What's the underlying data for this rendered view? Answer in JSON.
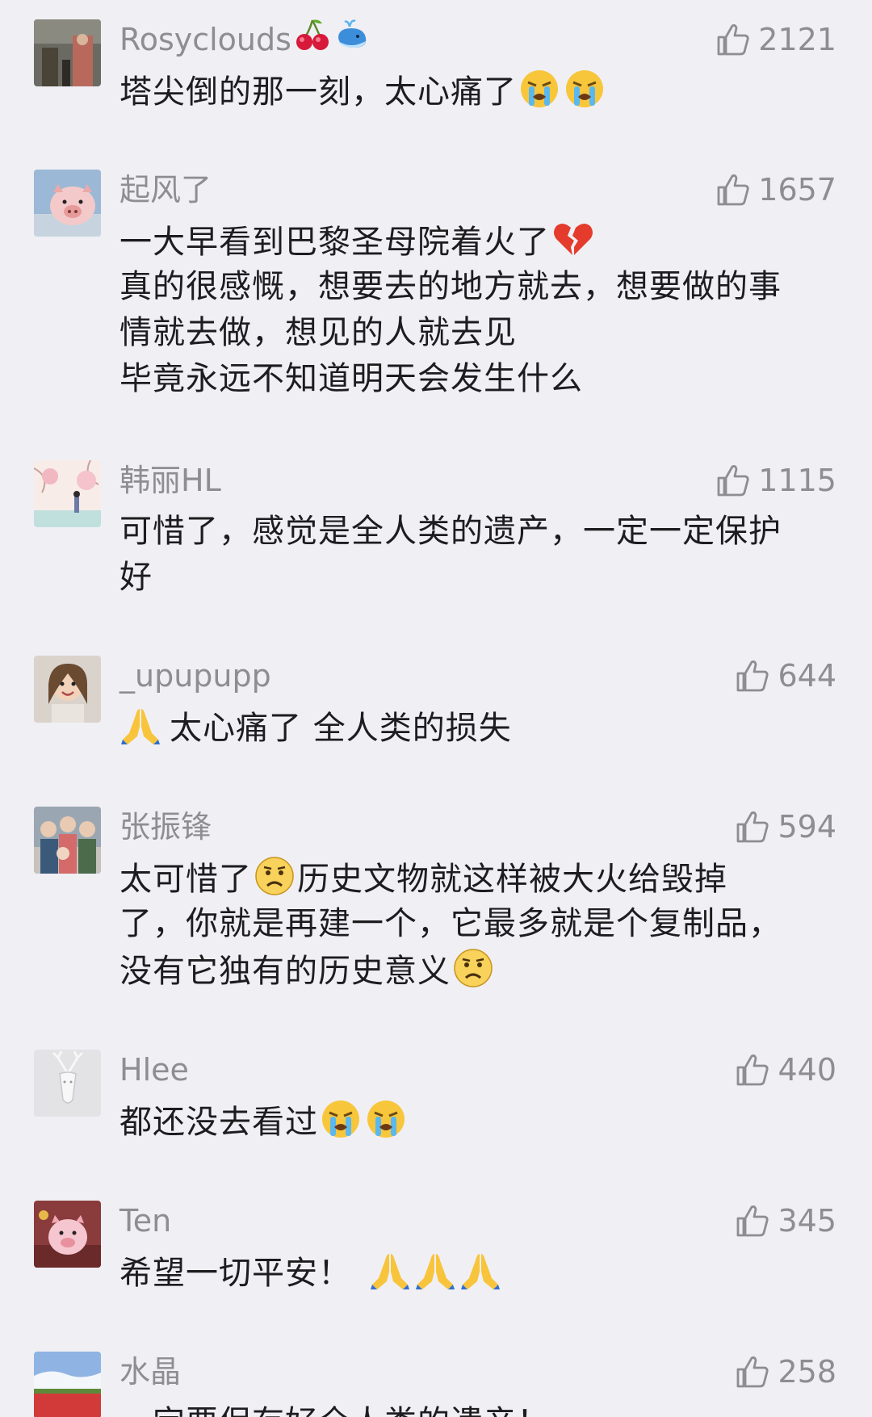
{
  "comments": [
    {
      "username": "Rosyclouds",
      "likes": "2121",
      "lines": [
        "塔尖倒的那一刻，太心痛了"
      ],
      "username_emoji": [
        "cherry-emoji",
        "whale-emoji"
      ],
      "trailing_emoji": [
        "crying-emoji",
        "crying-emoji"
      ]
    },
    {
      "username": "起风了",
      "likes": "1657",
      "lines": [
        "一大早看到巴黎圣母院着火了",
        "真的很感慨，想要去的地方就去，想要做的事",
        "情就去做，想见的人就去见",
        "毕竟永远不知道明天会发生什么"
      ],
      "trailing_emoji_line0": [
        "broken-heart-emoji"
      ]
    },
    {
      "username": "韩丽HL",
      "likes": "1115",
      "lines": [
        "可惜了，感觉是全人类的遗产，一定一定保护",
        "好"
      ]
    },
    {
      "username": "_upupupp",
      "likes": "644",
      "lines": [
        "太心痛了 全人类的损失"
      ],
      "leading_emoji": [
        "praying-hands-emoji"
      ]
    },
    {
      "username": "张振锋",
      "likes": "594",
      "lines": [
        "太可惜了",
        "历史文物就这样被大火给毁掉",
        "了，你就是再建一个，它最多就是个复制品，",
        "没有它独有的历史意义"
      ],
      "emoji": [
        "sad-face-emoji"
      ]
    },
    {
      "username": "Hlee",
      "likes": "440",
      "lines": [
        "都还没去看过"
      ],
      "trailing_emoji": [
        "crying-emoji",
        "crying-emoji"
      ]
    },
    {
      "username": "Ten",
      "likes": "345",
      "lines": [
        "希望一切平安！"
      ],
      "trailing_emoji": [
        "praying-hands-emoji",
        "praying-hands-emoji",
        "praying-hands-emoji"
      ]
    },
    {
      "username": "水晶",
      "likes": "258",
      "lines": [
        "一定要保存好全人类的遗产！"
      ]
    }
  ],
  "colors": {
    "background": "#f0eff4",
    "username": "#8d8d92",
    "text": "#1d1d1f",
    "like_icon": "#8d8d92"
  }
}
